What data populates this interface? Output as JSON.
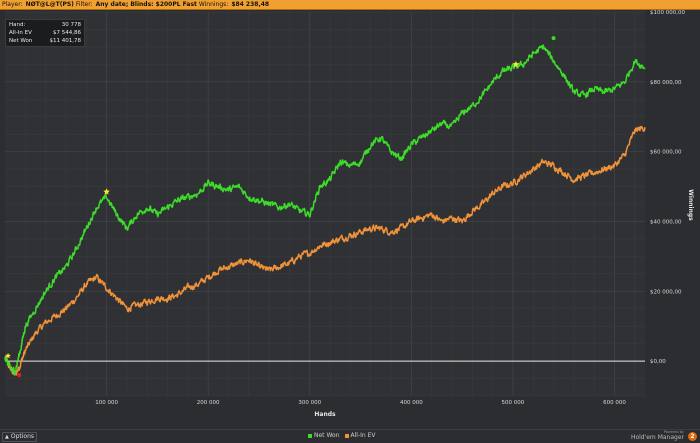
{
  "header": {
    "player_label": "Player:",
    "player_value": "NØT@L@T(PS)",
    "filter_label": "Filter:",
    "filter_value": "Any date; Blinds: $200PL Fast",
    "winnings_label": "Winnings:",
    "winnings_value": "$84 238,48"
  },
  "info": {
    "hands_label": "Hand:",
    "hands_value": "30 778",
    "ev_label": "All-In EV",
    "ev_value": "$7 544,86",
    "net_label": "Net Won",
    "net_value": "$11 401,78"
  },
  "footer": {
    "options_label": "Options",
    "powered_by": "Powered by",
    "brand_name": "Hold'em Manager",
    "brand_badge": "2"
  },
  "colors": {
    "net_won": "#3ddc2a",
    "all_in_ev": "#f0923a",
    "background": "#2b2d30",
    "grid": "#3d4044"
  },
  "chart_data": {
    "type": "line",
    "xlabel": "Hands",
    "ylabel": "Winnings",
    "xlim": [
      0,
      630000
    ],
    "ylim": [
      -10000,
      100000
    ],
    "x_ticks": [
      100000,
      200000,
      300000,
      400000,
      500000,
      600000
    ],
    "x_tick_labels": [
      "100 000",
      "200 000",
      "300 000",
      "400 000",
      "500 000",
      "600 000"
    ],
    "y_ticks": [
      0,
      20000,
      40000,
      60000,
      80000,
      100000
    ],
    "y_tick_labels": [
      "$0,00",
      "$20 000,00",
      "$40 000,00",
      "$60 000,00",
      "$80 000,00",
      "$100 000,00"
    ],
    "grid": true,
    "legend_position": "bottom-center",
    "series": [
      {
        "name": "Net Won",
        "color": "#3ddc2a",
        "x": [
          0,
          5000,
          10000,
          15000,
          20000,
          30000,
          40000,
          50000,
          60000,
          70000,
          80000,
          90000,
          100000,
          110000,
          120000,
          130000,
          140000,
          150000,
          160000,
          170000,
          180000,
          190000,
          200000,
          210000,
          220000,
          230000,
          240000,
          250000,
          260000,
          270000,
          280000,
          290000,
          300000,
          310000,
          320000,
          330000,
          340000,
          350000,
          360000,
          370000,
          380000,
          390000,
          400000,
          410000,
          420000,
          430000,
          440000,
          450000,
          460000,
          470000,
          480000,
          490000,
          500000,
          510000,
          520000,
          530000,
          540000,
          550000,
          560000,
          570000,
          580000,
          590000,
          600000,
          610000,
          620000,
          630000
        ],
        "y": [
          1000,
          -2000,
          -3000,
          3000,
          10000,
          15000,
          20000,
          24000,
          27000,
          32000,
          38000,
          44000,
          47000,
          42000,
          38000,
          42000,
          44000,
          42000,
          44000,
          46000,
          47000,
          48000,
          51000,
          50000,
          49000,
          50000,
          47000,
          46000,
          45000,
          44000,
          45000,
          43000,
          42000,
          50000,
          52000,
          57000,
          56000,
          57000,
          62000,
          64000,
          60000,
          58000,
          62000,
          64000,
          66000,
          68000,
          67000,
          71000,
          73000,
          76000,
          80000,
          83000,
          84000,
          85000,
          88000,
          90000,
          86000,
          82000,
          77000,
          76000,
          78000,
          77000,
          78000,
          80000,
          86000,
          84000
        ]
      },
      {
        "name": "All-In EV",
        "color": "#f0923a",
        "x": [
          0,
          5000,
          10000,
          15000,
          20000,
          30000,
          40000,
          50000,
          60000,
          70000,
          80000,
          90000,
          100000,
          110000,
          120000,
          130000,
          140000,
          150000,
          160000,
          170000,
          180000,
          190000,
          200000,
          210000,
          220000,
          230000,
          240000,
          250000,
          260000,
          270000,
          280000,
          290000,
          300000,
          310000,
          320000,
          330000,
          340000,
          350000,
          360000,
          370000,
          380000,
          390000,
          400000,
          410000,
          420000,
          430000,
          440000,
          450000,
          460000,
          470000,
          480000,
          490000,
          500000,
          510000,
          520000,
          530000,
          540000,
          550000,
          560000,
          570000,
          580000,
          590000,
          600000,
          610000,
          620000,
          630000
        ],
        "y": [
          1000,
          -2000,
          -4000,
          -1000,
          3000,
          8000,
          11000,
          13000,
          15000,
          18000,
          22000,
          24000,
          21000,
          18000,
          15000,
          16000,
          17000,
          18000,
          18000,
          19000,
          21000,
          22000,
          24000,
          26000,
          27000,
          28000,
          29000,
          27000,
          26000,
          27000,
          28000,
          30000,
          31000,
          33000,
          34000,
          35000,
          36000,
          37000,
          38000,
          38000,
          37000,
          38000,
          40000,
          41000,
          42000,
          40000,
          41000,
          40000,
          43000,
          45000,
          48000,
          50000,
          51000,
          53000,
          55000,
          57000,
          56000,
          54000,
          52000,
          53000,
          54000,
          55000,
          56000,
          59000,
          66000,
          67000
        ]
      }
    ]
  }
}
